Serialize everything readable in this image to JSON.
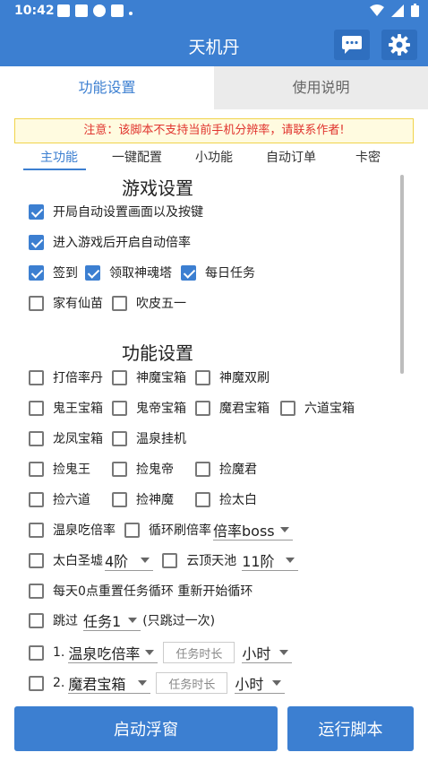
{
  "status_bar": {
    "time": "10:42"
  },
  "app_bar": {
    "title": "天机丹"
  },
  "tabs": [
    {
      "label": "功能设置"
    },
    {
      "label": "使用说明"
    }
  ],
  "notice": "注意：该脚本不支持当前手机分辨率，请联系作者!",
  "sub_tabs": [
    {
      "label": "主功能"
    },
    {
      "label": "一键配置"
    },
    {
      "label": "小功能"
    },
    {
      "label": "自动订单"
    },
    {
      "label": "卡密"
    }
  ],
  "game_settings": {
    "title": "游戏设置",
    "auto_setup": {
      "label": "开局自动设置画面以及按键",
      "checked": true
    },
    "auto_multiplier": {
      "label": "进入游戏后开启自动倍率",
      "checked": true
    },
    "sign_in": {
      "label": "签到",
      "checked": true
    },
    "soul_tower": {
      "label": "领取神魂塔",
      "checked": true
    },
    "daily_task": {
      "label": "每日任务",
      "checked": true
    },
    "xianmiao": {
      "label": "家有仙苗",
      "checked": false
    },
    "wuyi": {
      "label": "吹皮五一",
      "checked": false
    }
  },
  "function_settings": {
    "title": "功能设置",
    "items": [
      {
        "label": "打倍率丹",
        "checked": false
      },
      {
        "label": "神魔宝箱",
        "checked": false
      },
      {
        "label": "神魔双刷",
        "checked": false
      },
      {
        "label": "鬼王宝箱",
        "checked": false
      },
      {
        "label": "鬼帝宝箱",
        "checked": false
      },
      {
        "label": "魔君宝箱",
        "checked": false
      },
      {
        "label": "六道宝箱",
        "checked": false
      },
      {
        "label": "龙凤宝箱",
        "checked": false
      },
      {
        "label": "温泉挂机",
        "checked": false
      },
      {
        "label": "捡鬼王",
        "checked": false
      },
      {
        "label": "捡鬼帝",
        "checked": false
      },
      {
        "label": "捡魔君",
        "checked": false
      },
      {
        "label": "捡六道",
        "checked": false
      },
      {
        "label": "捡神魔",
        "checked": false
      },
      {
        "label": "捡太白",
        "checked": false
      }
    ],
    "hot_spring": {
      "label": "温泉吃倍率",
      "checked": false
    },
    "loop_multiplier": {
      "label": "循环刷倍率",
      "checked": false,
      "select": "倍率boss"
    },
    "taibai": {
      "label": "太白圣墟",
      "checked": false,
      "select": "4阶"
    },
    "yunding": {
      "label": "云顶天池",
      "checked": false,
      "select": "11阶"
    },
    "daily_reset": {
      "label": "每天0点重置任务循环 重新开始循环",
      "checked": false
    },
    "skip": {
      "label": "跳过",
      "checked": false,
      "select": "任务1",
      "hint": "(只跳过一次)"
    },
    "tasks": [
      {
        "index": "1.",
        "select": "温泉吃倍率",
        "placeholder": "任务时长",
        "unit": "小时",
        "checked": false
      },
      {
        "index": "2.",
        "select": "魔君宝箱",
        "placeholder": "任务时长",
        "unit": "小时",
        "checked": false
      }
    ]
  },
  "buttons": {
    "float_window": "启动浮窗",
    "run_script": "运行脚本"
  }
}
